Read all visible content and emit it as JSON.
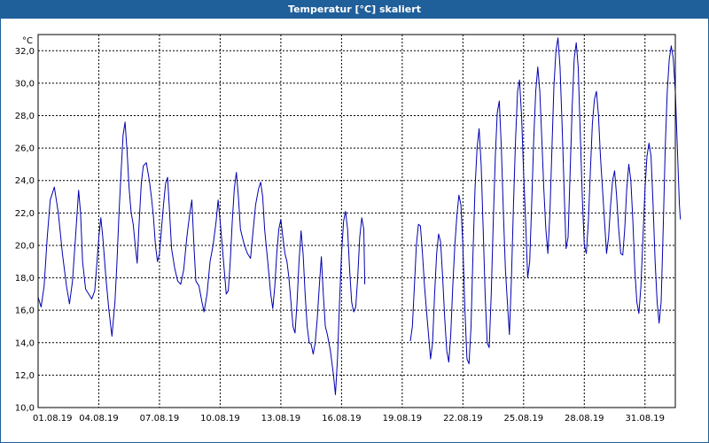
{
  "window": {
    "title": "Temperatur [°C] skaliert"
  },
  "chart_data": {
    "type": "line",
    "title": "Temperatur [°C] skaliert",
    "ylabel": "°C",
    "xlabel": "",
    "ylim": [
      10.0,
      33.0
    ],
    "y_ticks": [
      "10,0",
      "12,0",
      "14,0",
      "16,0",
      "18,0",
      "20,0",
      "22,0",
      "24,0",
      "26,0",
      "28,0",
      "30,0",
      "32,0"
    ],
    "x_ticks": [
      "01.08.19",
      "04.08.19",
      "07.08.19",
      "10.08.19",
      "13.08.19",
      "16.08.19",
      "19.08.19",
      "22.08.19",
      "25.08.19",
      "28.08.19",
      "31.08.19"
    ],
    "x_range_days": [
      0,
      31.5
    ],
    "grid": true,
    "line_color": "#0000b0",
    "grid_color": "#000000",
    "series": [
      {
        "segments": [
          [
            [
              0.0,
              16.8
            ],
            [
              0.15,
              16.2
            ],
            [
              0.3,
              17.5
            ],
            [
              0.45,
              20.5
            ],
            [
              0.6,
              22.8
            ],
            [
              0.8,
              23.6
            ],
            [
              1.0,
              22.0
            ],
            [
              1.2,
              19.5
            ],
            [
              1.4,
              17.5
            ],
            [
              1.55,
              16.4
            ],
            [
              1.7,
              17.8
            ],
            [
              1.85,
              20.5
            ],
            [
              2.0,
              23.4
            ],
            [
              2.1,
              22.0
            ],
            [
              2.2,
              19.0
            ],
            [
              2.35,
              17.3
            ],
            [
              2.5,
              17.0
            ],
            [
              2.65,
              16.7
            ],
            [
              2.8,
              17.2
            ],
            [
              2.9,
              18.8
            ],
            [
              3.0,
              20.5
            ],
            [
              3.1,
              21.7
            ],
            [
              3.2,
              20.5
            ],
            [
              3.35,
              18.0
            ],
            [
              3.5,
              16.0
            ],
            [
              3.65,
              14.4
            ],
            [
              3.8,
              16.5
            ],
            [
              3.9,
              19.0
            ],
            [
              4.0,
              22.0
            ],
            [
              4.1,
              24.5
            ],
            [
              4.2,
              26.8
            ],
            [
              4.3,
              27.6
            ],
            [
              4.4,
              25.8
            ],
            [
              4.5,
              23.5
            ],
            [
              4.6,
              22.0
            ],
            [
              4.7,
              21.3
            ],
            [
              4.8,
              20.0
            ],
            [
              4.9,
              18.9
            ],
            [
              5.0,
              21.5
            ],
            [
              5.1,
              23.8
            ],
            [
              5.2,
              24.9
            ],
            [
              5.35,
              25.1
            ],
            [
              5.5,
              24.0
            ],
            [
              5.6,
              23.0
            ],
            [
              5.7,
              21.8
            ],
            [
              5.8,
              20.0
            ],
            [
              5.9,
              19.0
            ],
            [
              6.0,
              19.5
            ],
            [
              6.1,
              21.0
            ],
            [
              6.2,
              22.5
            ],
            [
              6.3,
              23.8
            ],
            [
              6.4,
              24.2
            ],
            [
              6.5,
              22.0
            ],
            [
              6.6,
              19.8
            ],
            [
              6.75,
              18.6
            ],
            [
              6.9,
              17.8
            ],
            [
              7.05,
              17.6
            ],
            [
              7.2,
              18.5
            ],
            [
              7.35,
              20.5
            ],
            [
              7.5,
              22.0
            ],
            [
              7.6,
              22.8
            ],
            [
              7.7,
              20.0
            ],
            [
              7.8,
              17.8
            ],
            [
              7.95,
              17.5
            ],
            [
              8.1,
              16.5
            ],
            [
              8.2,
              15.9
            ],
            [
              8.35,
              17.0
            ],
            [
              8.5,
              19.0
            ],
            [
              8.65,
              20.0
            ],
            [
              8.8,
              21.5
            ],
            [
              8.9,
              22.8
            ],
            [
              9.0,
              21.5
            ],
            [
              9.1,
              20.0
            ],
            [
              9.2,
              18.5
            ],
            [
              9.3,
              17.0
            ],
            [
              9.4,
              17.2
            ],
            [
              9.5,
              19.0
            ],
            [
              9.6,
              21.5
            ],
            [
              9.7,
              23.5
            ],
            [
              9.8,
              24.5
            ],
            [
              9.9,
              23.0
            ],
            [
              10.0,
              21.0
            ],
            [
              10.1,
              20.5
            ],
            [
              10.2,
              20.0
            ],
            [
              10.35,
              19.5
            ],
            [
              10.5,
              19.2
            ],
            [
              10.6,
              20.5
            ],
            [
              10.75,
              22.5
            ],
            [
              10.9,
              23.5
            ],
            [
              11.0,
              23.9
            ],
            [
              11.1,
              23.0
            ],
            [
              11.2,
              21.0
            ],
            [
              11.35,
              19.0
            ],
            [
              11.5,
              17.0
            ],
            [
              11.6,
              16.1
            ],
            [
              11.7,
              17.5
            ],
            [
              11.8,
              19.5
            ],
            [
              11.9,
              21.0
            ],
            [
              12.0,
              21.6
            ],
            [
              12.1,
              20.5
            ],
            [
              12.2,
              19.5
            ],
            [
              12.3,
              19.0
            ],
            [
              12.4,
              18.0
            ],
            [
              12.5,
              16.5
            ],
            [
              12.6,
              15.0
            ],
            [
              12.7,
              14.6
            ],
            [
              12.8,
              16.5
            ],
            [
              12.9,
              19.0
            ],
            [
              13.0,
              20.9
            ],
            [
              13.1,
              19.5
            ],
            [
              13.2,
              17.0
            ],
            [
              13.3,
              15.0
            ],
            [
              13.4,
              14.0
            ],
            [
              13.5,
              13.9
            ],
            [
              13.6,
              13.3
            ],
            [
              13.7,
              14.0
            ],
            [
              13.8,
              15.5
            ],
            [
              13.9,
              17.5
            ],
            [
              14.0,
              19.3
            ],
            [
              14.1,
              17.0
            ],
            [
              14.2,
              15.0
            ],
            [
              14.3,
              14.5
            ],
            [
              14.45,
              13.5
            ],
            [
              14.6,
              12.0
            ],
            [
              14.7,
              10.8
            ],
            [
              14.8,
              13.0
            ],
            [
              14.9,
              16.5
            ],
            [
              15.0,
              19.5
            ],
            [
              15.1,
              21.5
            ],
            [
              15.2,
              22.1
            ],
            [
              15.3,
              21.0
            ],
            [
              15.4,
              18.5
            ],
            [
              15.5,
              16.5
            ],
            [
              15.6,
              15.9
            ],
            [
              15.7,
              16.2
            ],
            [
              15.8,
              18.0
            ],
            [
              15.9,
              20.5
            ],
            [
              16.0,
              21.7
            ],
            [
              16.1,
              21.0
            ],
            [
              16.15,
              17.6
            ]
          ],
          [
            [
              18.4,
              14.1
            ],
            [
              18.5,
              15.0
            ],
            [
              18.6,
              17.5
            ],
            [
              18.7,
              20.0
            ],
            [
              18.8,
              21.3
            ],
            [
              18.9,
              21.2
            ],
            [
              19.0,
              19.5
            ],
            [
              19.1,
              17.5
            ],
            [
              19.2,
              16.0
            ],
            [
              19.3,
              14.5
            ],
            [
              19.4,
              13.0
            ],
            [
              19.5,
              14.0
            ],
            [
              19.6,
              17.0
            ],
            [
              19.7,
              19.5
            ],
            [
              19.8,
              20.7
            ],
            [
              19.9,
              20.2
            ],
            [
              20.0,
              18.0
            ],
            [
              20.1,
              15.5
            ],
            [
              20.2,
              13.5
            ],
            [
              20.3,
              12.8
            ],
            [
              20.4,
              14.5
            ],
            [
              20.5,
              17.5
            ],
            [
              20.6,
              20.0
            ],
            [
              20.7,
              21.8
            ],
            [
              20.8,
              23.1
            ],
            [
              20.9,
              22.5
            ],
            [
              21.0,
              20.0
            ],
            [
              21.1,
              16.0
            ],
            [
              21.2,
              13.0
            ],
            [
              21.3,
              12.7
            ],
            [
              21.4,
              15.0
            ],
            [
              21.5,
              19.5
            ],
            [
              21.6,
              23.5
            ],
            [
              21.7,
              26.0
            ],
            [
              21.8,
              27.2
            ],
            [
              21.9,
              25.0
            ],
            [
              22.0,
              21.0
            ],
            [
              22.1,
              17.0
            ],
            [
              22.2,
              14.0
            ],
            [
              22.3,
              13.7
            ],
            [
              22.4,
              17.0
            ],
            [
              22.5,
              21.5
            ],
            [
              22.6,
              25.5
            ],
            [
              22.7,
              28.2
            ],
            [
              22.8,
              28.9
            ],
            [
              22.9,
              26.0
            ],
            [
              23.0,
              22.0
            ],
            [
              23.1,
              18.5
            ],
            [
              23.2,
              16.5
            ],
            [
              23.3,
              14.5
            ],
            [
              23.4,
              18.0
            ],
            [
              23.5,
              22.5
            ],
            [
              23.6,
              26.5
            ],
            [
              23.7,
              29.5
            ],
            [
              23.8,
              30.2
            ],
            [
              23.9,
              28.0
            ],
            [
              24.0,
              24.5
            ],
            [
              24.1,
              21.5
            ],
            [
              24.2,
              18.0
            ],
            [
              24.3,
              19.0
            ],
            [
              24.4,
              22.5
            ],
            [
              24.5,
              26.5
            ],
            [
              24.6,
              29.5
            ],
            [
              24.7,
              31.0
            ],
            [
              24.8,
              29.5
            ],
            [
              24.9,
              26.5
            ],
            [
              25.0,
              23.5
            ],
            [
              25.1,
              21.0
            ],
            [
              25.2,
              19.5
            ],
            [
              25.3,
              22.0
            ],
            [
              25.4,
              26.0
            ],
            [
              25.5,
              29.8
            ],
            [
              25.6,
              32.0
            ],
            [
              25.7,
              32.8
            ],
            [
              25.8,
              31.0
            ],
            [
              25.9,
              27.5
            ],
            [
              26.0,
              23.5
            ],
            [
              26.1,
              19.8
            ],
            [
              26.2,
              20.5
            ],
            [
              26.3,
              24.5
            ],
            [
              26.4,
              28.5
            ],
            [
              26.5,
              31.5
            ],
            [
              26.6,
              32.5
            ],
            [
              26.7,
              31.0
            ],
            [
              26.8,
              27.0
            ],
            [
              26.9,
              23.0
            ],
            [
              27.0,
              20.0
            ],
            [
              27.1,
              19.5
            ],
            [
              27.2,
              21.5
            ],
            [
              27.3,
              24.5
            ],
            [
              27.4,
              27.5
            ],
            [
              27.5,
              29.0
            ],
            [
              27.6,
              29.5
            ],
            [
              27.7,
              28.0
            ],
            [
              27.8,
              25.5
            ],
            [
              27.9,
              23.5
            ],
            [
              28.0,
              21.5
            ],
            [
              28.1,
              19.5
            ],
            [
              28.2,
              20.5
            ],
            [
              28.3,
              22.5
            ],
            [
              28.4,
              24.0
            ],
            [
              28.5,
              24.6
            ],
            [
              28.6,
              23.0
            ],
            [
              28.7,
              21.0
            ],
            [
              28.8,
              19.5
            ],
            [
              28.9,
              19.4
            ],
            [
              29.0,
              21.0
            ],
            [
              29.1,
              23.5
            ],
            [
              29.2,
              25.0
            ],
            [
              29.3,
              24.0
            ],
            [
              29.4,
              21.5
            ],
            [
              29.5,
              18.5
            ],
            [
              29.6,
              16.5
            ],
            [
              29.7,
              15.8
            ],
            [
              29.8,
              17.5
            ],
            [
              29.9,
              20.5
            ],
            [
              30.0,
              23.5
            ],
            [
              30.1,
              25.5
            ],
            [
              30.2,
              26.3
            ],
            [
              30.3,
              25.5
            ],
            [
              30.4,
              22.5
            ],
            [
              30.5,
              19.0
            ],
            [
              30.6,
              16.5
            ],
            [
              30.7,
              15.2
            ],
            [
              30.8,
              16.5
            ],
            [
              30.9,
              21.0
            ],
            [
              31.0,
              26.0
            ],
            [
              31.1,
              29.5
            ],
            [
              31.2,
              31.5
            ],
            [
              31.3,
              32.3
            ],
            [
              31.4,
              31.5
            ],
            [
              31.5,
              29.5
            ],
            [
              31.6,
              26.0
            ],
            [
              31.7,
              22.5
            ],
            [
              31.75,
              21.6
            ]
          ]
        ]
      }
    ]
  }
}
